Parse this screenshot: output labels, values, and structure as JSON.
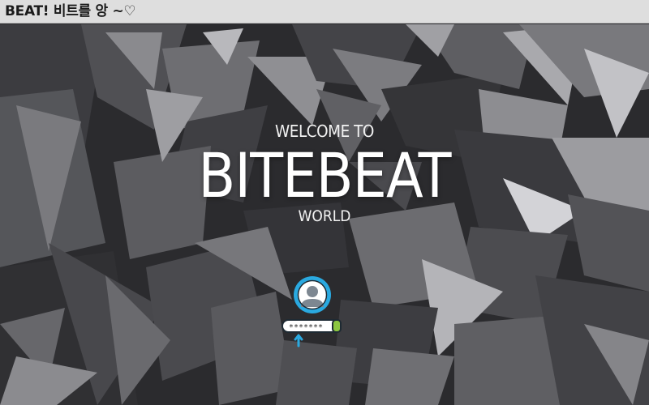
{
  "header": {
    "site_title": "BEAT! 비트를 앙 ~♡"
  },
  "hero": {
    "welcome": "WELCOME TO",
    "brand": "BITEBEAT",
    "world": "WORLD"
  },
  "login": {
    "icon": "user-login-icon",
    "password_mask": "*******"
  },
  "colors": {
    "background": "#2a2a2c",
    "topbar": "#ececec",
    "hero_text": "#ffffff",
    "avatar_ring": "#2aa9e0",
    "avatar_body": "#7d8791",
    "field_fill": "#ffffff",
    "field_accent": "#8cc63f"
  }
}
